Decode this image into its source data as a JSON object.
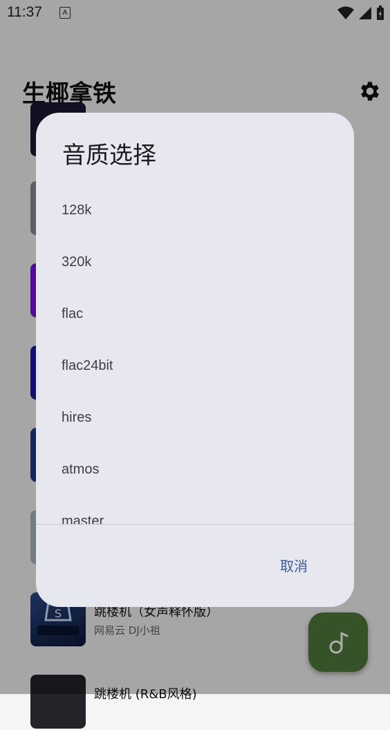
{
  "status": {
    "time": "11:37",
    "notif": "A"
  },
  "app": {
    "title": "生椰拿铁"
  },
  "songs": [
    {
      "title": "跳楼机（女声释怀版）",
      "sub": "网易云   DJ小祖"
    },
    {
      "title": "跳楼机 (R&B风格)",
      "sub": ""
    }
  ],
  "dialog": {
    "title": "音质选择",
    "options": [
      "128k",
      "320k",
      "flac",
      "flac24bit",
      "hires",
      "atmos",
      "master"
    ],
    "cancel_label": "取消"
  },
  "colors": {
    "accent": "#3a5aa0",
    "fab": "#4e7a3b",
    "dialog_bg": "#e7e8ef"
  }
}
